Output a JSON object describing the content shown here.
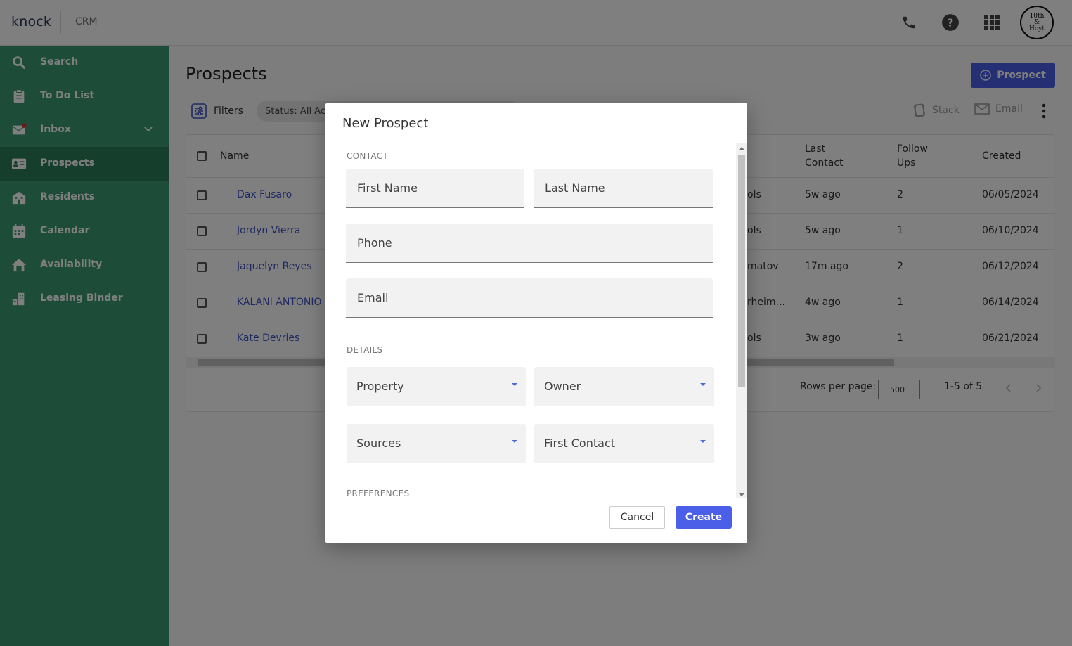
{
  "header": {
    "logo": "knock",
    "app_name": "CRM",
    "avatar_text": "10th & Hoyt",
    "icons": [
      "phone-icon",
      "help-icon",
      "apps-grid-icon"
    ]
  },
  "sidebar": {
    "items": [
      {
        "label": "Search",
        "icon": "search-icon"
      },
      {
        "label": "To Do List",
        "icon": "clipboard-icon"
      },
      {
        "label": "Inbox",
        "icon": "mail-icon"
      },
      {
        "label": "Prospects",
        "icon": "id-card-icon",
        "active": true
      },
      {
        "label": "Residents",
        "icon": "building-icon"
      },
      {
        "label": "Calendar",
        "icon": "calendar-icon"
      },
      {
        "label": "Availability",
        "icon": "home-icon"
      },
      {
        "label": "Leasing Binder",
        "icon": "city-icon"
      }
    ]
  },
  "main": {
    "title": "Prospects",
    "add_button": "Prospect",
    "filters_label": "Filters",
    "status_chip": "Status: All Act",
    "actions": {
      "stack": "Stack",
      "email": "Email"
    },
    "table": {
      "headers": {
        "name": "Name",
        "last_contact": "Last Contact",
        "follow_ups": "Follow Ups",
        "created": "Created"
      },
      "rows": [
        {
          "name": "Dax Fusaro",
          "partial": "ols",
          "last_contact": "5w ago",
          "follow_ups": "2",
          "created": "06/05/2024"
        },
        {
          "name": "Jordyn Vierra",
          "partial": "ols",
          "last_contact": "5w ago",
          "follow_ups": "1",
          "created": "06/10/2024"
        },
        {
          "name": "Jaquelyn Reyes",
          "partial": "matov",
          "last_contact": "17m ago",
          "follow_ups": "2",
          "created": "06/12/2024"
        },
        {
          "name": "KALANI ANTONIO",
          "partial": "rheim...",
          "last_contact": "4w ago",
          "follow_ups": "1",
          "created": "06/14/2024"
        },
        {
          "name": "Kate Devries",
          "partial": "ols",
          "last_contact": "3w ago",
          "follow_ups": "1",
          "created": "06/21/2024"
        }
      ]
    },
    "pagination": {
      "rows_per_page_label": "Rows per page:",
      "rows_per_page": "500",
      "range": "1-5 of 5"
    }
  },
  "modal": {
    "title": "New Prospect",
    "sections": {
      "contact": "CONTACT",
      "details": "DETAILS",
      "preferences": "PREFERENCES"
    },
    "fields": {
      "first_name": {
        "placeholder": "First Name",
        "value": ""
      },
      "last_name": {
        "placeholder": "Last Name",
        "value": ""
      },
      "phone": {
        "placeholder": "Phone",
        "value": ""
      },
      "email": {
        "placeholder": "Email",
        "value": ""
      },
      "property": {
        "label": "Property"
      },
      "owner": {
        "label": "Owner"
      },
      "sources": {
        "label": "Sources"
      },
      "first_contact": {
        "label": "First Contact"
      }
    },
    "buttons": {
      "cancel": "Cancel",
      "create": "Create"
    }
  },
  "colors": {
    "sidebar": "#3a9a72",
    "sidebar_active": "#2c7d5a",
    "primary": "#4a5ee8",
    "link": "#3e52c7"
  }
}
